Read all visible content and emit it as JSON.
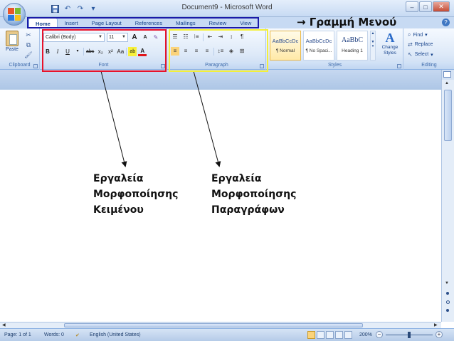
{
  "window": {
    "title": "Document9 - Microsoft Word",
    "controls": {
      "minimize": "–",
      "maximize": "□",
      "close": "✕"
    }
  },
  "quick_access": {
    "save_icon": "floppy-icon",
    "undo_glyph": "↶",
    "redo_glyph": "↷",
    "more_glyph": "▾"
  },
  "tabs": [
    "Home",
    "Insert",
    "Page Layout",
    "References",
    "Mailings",
    "Review",
    "View"
  ],
  "help_glyph": "?",
  "ribbon": {
    "clipboard": {
      "paste_label": "Paste",
      "group_label": "Clipboard"
    },
    "font": {
      "font_name": "Calibri (Body)",
      "font_size": "11",
      "grow": "A",
      "shrink": "A",
      "clear": "✎",
      "bold": "B",
      "italic": "I",
      "underline": "U",
      "strike": "abc",
      "subscript": "x₂",
      "superscript": "x²",
      "case": "Aa",
      "highlight": "ab",
      "color": "A",
      "group_label": "Font"
    },
    "paragraph": {
      "bullets": "☰",
      "numbering": "☷",
      "multilevel": "⁝≡",
      "decrease_indent": "⇤",
      "increase_indent": "⇥",
      "sort": "↕",
      "show_marks": "¶",
      "align_left": "≡",
      "center": "≡",
      "align_right": "≡",
      "justify": "≡",
      "line_spacing": "↕≡",
      "shading": "◈",
      "borders": "⊞",
      "group_label": "Paragraph"
    },
    "styles": {
      "items": [
        {
          "sample": "AaBbCcDc",
          "name": "¶ Normal"
        },
        {
          "sample": "AaBbCcDc",
          "name": "¶ No Spaci..."
        },
        {
          "sample": "AaBbC",
          "name": "Heading 1"
        }
      ],
      "change_styles_icon": "A",
      "change_styles_label": "Change Styles",
      "group_label": "Styles"
    },
    "editing": {
      "find": "Find",
      "replace": "Replace",
      "select": "Select",
      "group_label": "Editing"
    }
  },
  "status": {
    "page": "Page: 1 of 1",
    "words": "Words: 0",
    "language": "English (United States)",
    "zoom": "200%",
    "zoom_minus": "−",
    "zoom_plus": "+"
  },
  "annotations": {
    "menu_label": "→ Γραμμή Μενού",
    "font_caption": [
      "Εργαλεία",
      "Μορφοποίησης",
      "Κειμένου"
    ],
    "paragraph_caption": [
      "Εργαλεία",
      "Μορφοποίησης",
      "Παραγράφων"
    ],
    "colors": {
      "menu_box": "#1a1aa8",
      "font_box": "#e8122a",
      "paragraph_box": "#f3ef3a"
    }
  },
  "theme": {
    "ribbon_blue": "#c7daf3",
    "text_blue": "#15428b",
    "accent_gold": "#fbd37a"
  }
}
